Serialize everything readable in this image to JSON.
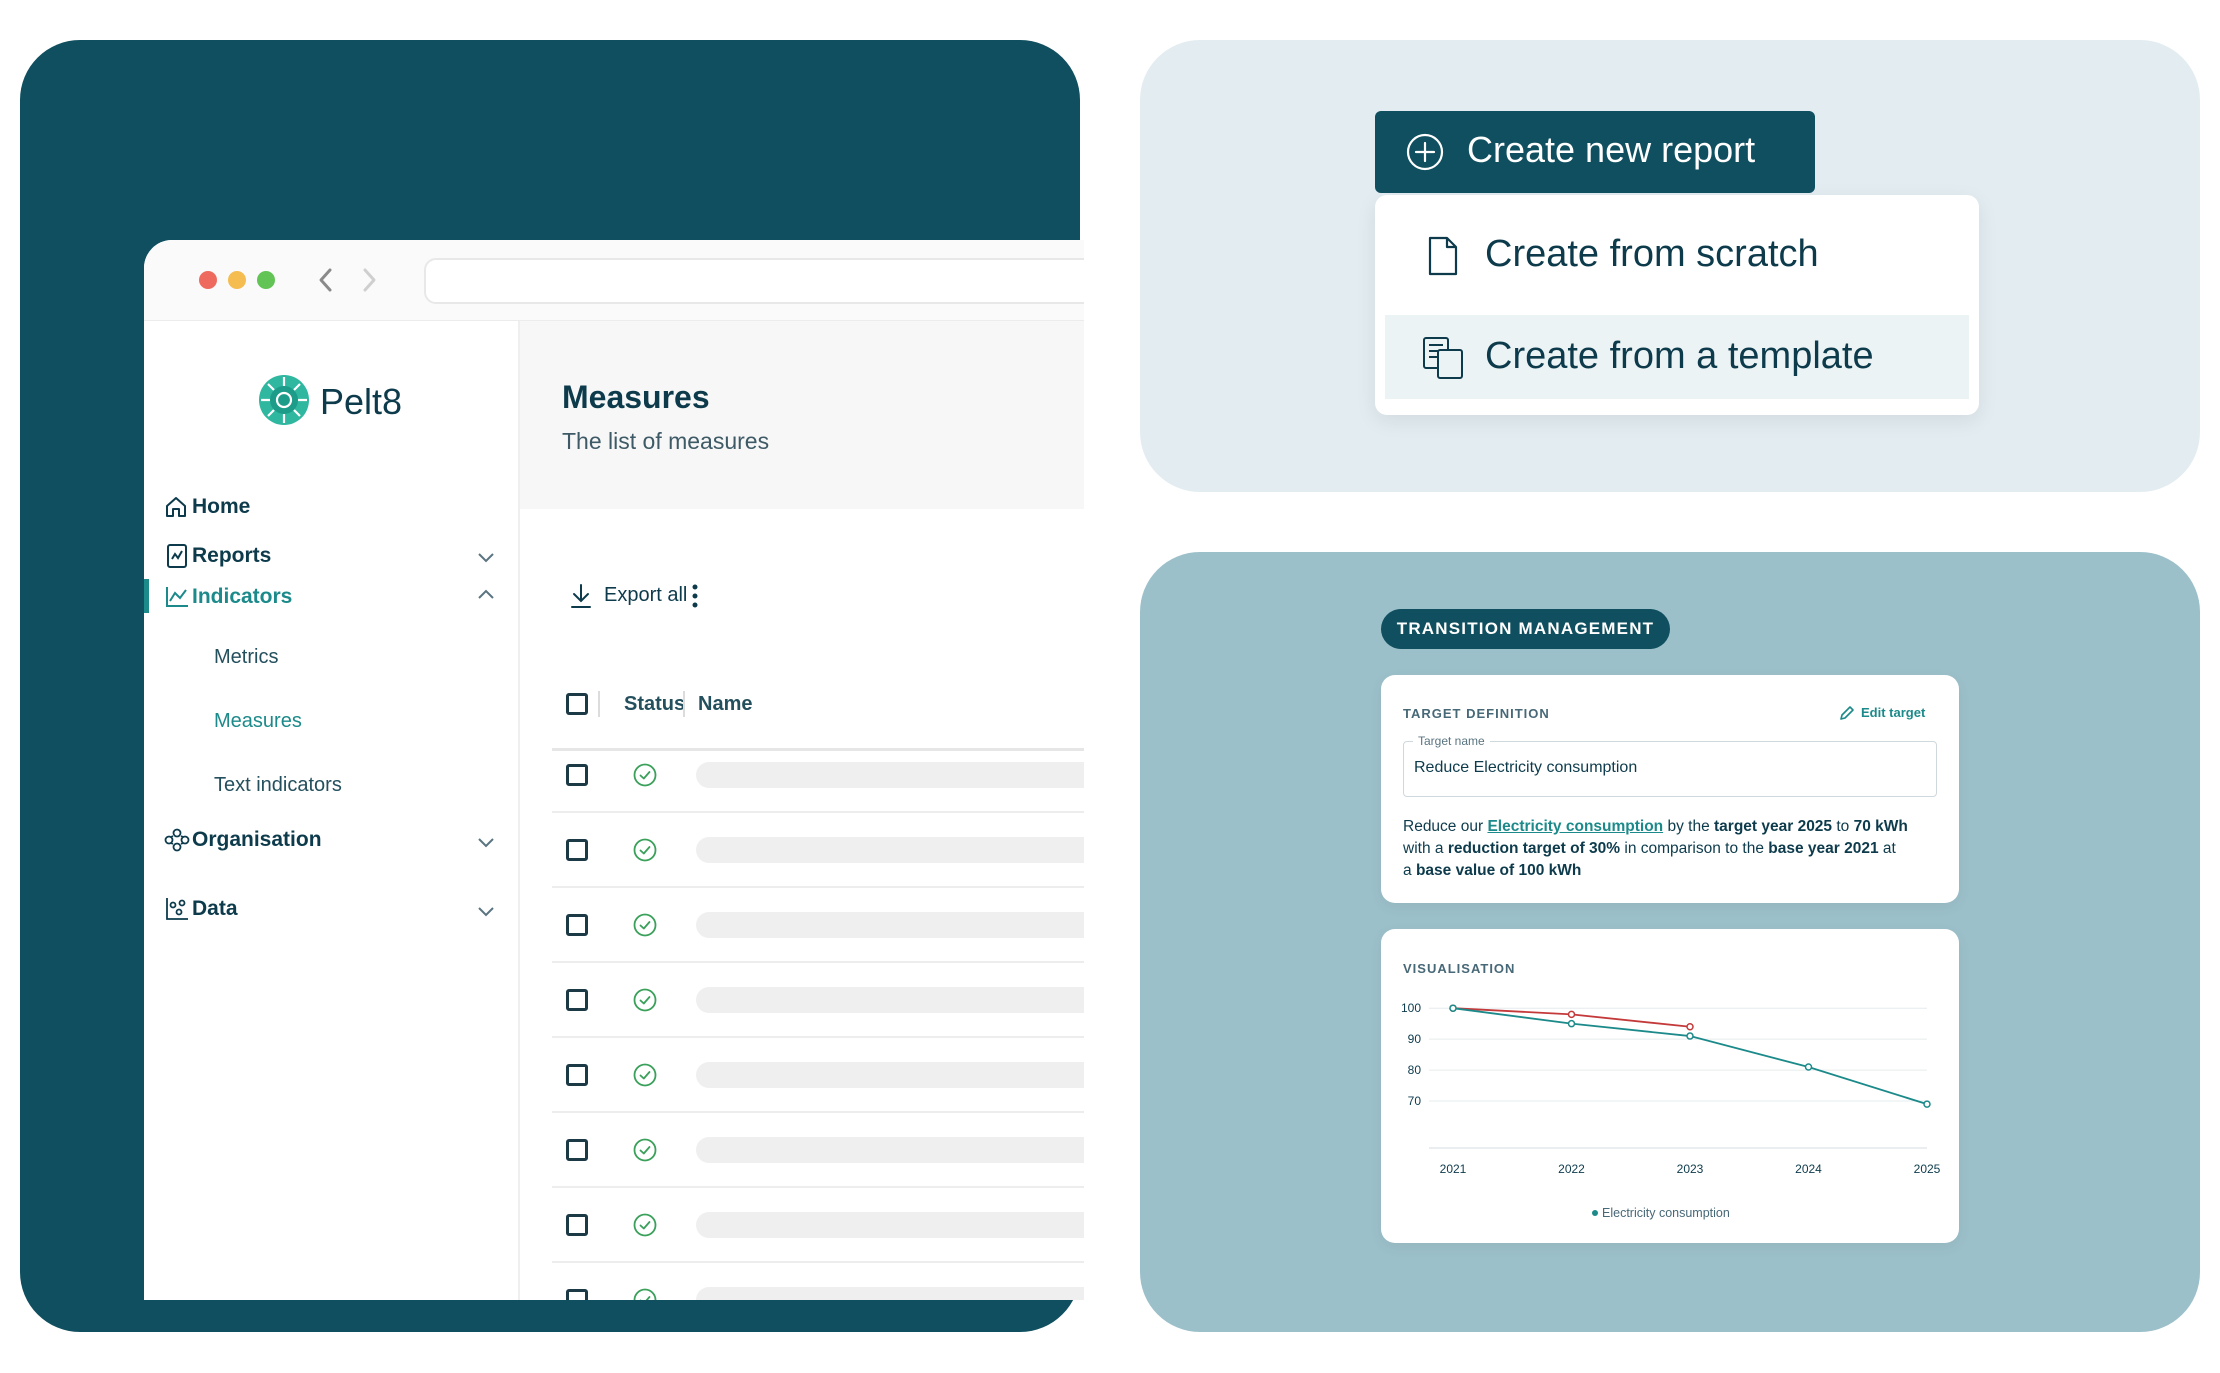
{
  "sidebar": {
    "brand": "Pelt8",
    "items": [
      {
        "label": "Home"
      },
      {
        "label": "Reports"
      },
      {
        "label": "Indicators"
      },
      {
        "label": "Metrics"
      },
      {
        "label": "Measures"
      },
      {
        "label": "Text indicators"
      },
      {
        "label": "Organisation"
      },
      {
        "label": "Data"
      }
    ]
  },
  "main": {
    "title": "Measures",
    "subtitle": "The list of measures",
    "export_label": "Export all",
    "columns": {
      "status": "Status",
      "name": "Name"
    },
    "row_count": 8
  },
  "report_menu": {
    "button_label": "Create new report",
    "options": [
      {
        "label": "Create from scratch"
      },
      {
        "label": "Create from a template"
      }
    ]
  },
  "transition": {
    "badge": "TRANSITION MANAGEMENT",
    "target": {
      "heading": "TARGET DEFINITION",
      "edit_label": "Edit target",
      "field_label": "Target name",
      "field_value": "Reduce Electricity consumption",
      "desc": {
        "p1": "Reduce our ",
        "link": "Electricity consumption",
        "p2": " by the ",
        "b1": "target year 2025",
        "p3": " to ",
        "b2": "70 kWh",
        "p4": "with a ",
        "b3": "reduction target of 30%",
        "p5": " in comparison to the ",
        "b4": "base year 2021",
        "p6": " at",
        "p7": "a ",
        "b5": "base value of 100 kWh"
      }
    },
    "visualisation": {
      "heading": "VISUALISATION"
    }
  },
  "colors": {
    "brand_dark": "#0f4f5f",
    "accent_teal": "#1c8a8a",
    "panel_light": "#e3edf1",
    "panel_blue": "#9cc0ca",
    "series_actual": "#c43a3a",
    "series_target": "#1c8a8a"
  },
  "chart_data": {
    "type": "line",
    "title": "",
    "xlabel": "",
    "ylabel": "",
    "x": [
      "2021",
      "2022",
      "2023",
      "2024",
      "2025"
    ],
    "yticks": [
      70,
      80,
      90,
      100
    ],
    "ylim": [
      60,
      102
    ],
    "grid": true,
    "legend_position": "bottom",
    "series": [
      {
        "name": "Electricity consumption",
        "color": "#1c8a8a",
        "values": [
          100,
          95,
          91,
          81,
          69
        ]
      },
      {
        "color": "#c43a3a",
        "values": [
          100,
          98,
          94,
          null,
          null
        ]
      }
    ]
  }
}
